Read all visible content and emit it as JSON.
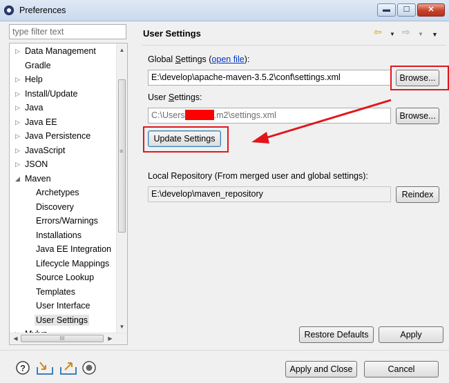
{
  "window": {
    "title": "Preferences",
    "minimize_glyph": "▬",
    "maximize_glyph": "☐",
    "close_glyph": "✕"
  },
  "sidebar": {
    "filter_placeholder": "type filter text",
    "items": [
      {
        "label": "Data Management",
        "level": 0,
        "expander": "collapsed"
      },
      {
        "label": "Gradle",
        "level": 0,
        "expander": "none"
      },
      {
        "label": "Help",
        "level": 0,
        "expander": "collapsed"
      },
      {
        "label": "Install/Update",
        "level": 0,
        "expander": "collapsed"
      },
      {
        "label": "Java",
        "level": 0,
        "expander": "collapsed"
      },
      {
        "label": "Java EE",
        "level": 0,
        "expander": "collapsed"
      },
      {
        "label": "Java Persistence",
        "level": 0,
        "expander": "collapsed"
      },
      {
        "label": "JavaScript",
        "level": 0,
        "expander": "collapsed"
      },
      {
        "label": "JSON",
        "level": 0,
        "expander": "collapsed"
      },
      {
        "label": "Maven",
        "level": 0,
        "expander": "expanded"
      },
      {
        "label": "Archetypes",
        "level": 1,
        "expander": "none"
      },
      {
        "label": "Discovery",
        "level": 1,
        "expander": "none"
      },
      {
        "label": "Errors/Warnings",
        "level": 1,
        "expander": "none"
      },
      {
        "label": "Installations",
        "level": 1,
        "expander": "none"
      },
      {
        "label": "Java EE Integration",
        "level": 1,
        "expander": "none"
      },
      {
        "label": "Lifecycle Mappings",
        "level": 1,
        "expander": "none"
      },
      {
        "label": "Source Lookup",
        "level": 1,
        "expander": "none"
      },
      {
        "label": "Templates",
        "level": 1,
        "expander": "none"
      },
      {
        "label": "User Interface",
        "level": 1,
        "expander": "none"
      },
      {
        "label": "User Settings",
        "level": 1,
        "expander": "none",
        "selected": true
      },
      {
        "label": "Mylyn",
        "level": 0,
        "expander": "collapsed"
      }
    ],
    "hscroll_thumb_glyph": "III"
  },
  "header": {
    "title": "User Settings",
    "back_glyph": "⇦",
    "forward_glyph": "⇨",
    "menu_glyph": "▼"
  },
  "main": {
    "global_label_prefix": "Global ",
    "global_label_mnemonic": "S",
    "global_label_rest": "ettings (",
    "global_link": "open file",
    "global_label_suffix": "):",
    "global_value": "E:\\develop\\apache-maven-3.5.2\\conf\\settings.xml",
    "browse_label": "Browse...",
    "user_label_prefix": "User ",
    "user_label_mnemonic": "S",
    "user_label_rest": "ettings:",
    "user_value_before": "C:\\Users",
    "user_value_after": ".m2\\settings.xml",
    "update_label": "Update Settings",
    "local_repo_label": "Local Repository (From merged user and global settings):",
    "local_repo_value": "E:\\develop\\maven_repository",
    "reindex_label": "Reindex",
    "restore_label": "Restore Defaults",
    "apply_label": "Apply"
  },
  "footer": {
    "apply_close_label": "Apply and Close",
    "cancel_label": "Cancel",
    "help_glyph": "?"
  },
  "colors": {
    "annotation_red": "#e0161c",
    "link": "#0033cc"
  }
}
